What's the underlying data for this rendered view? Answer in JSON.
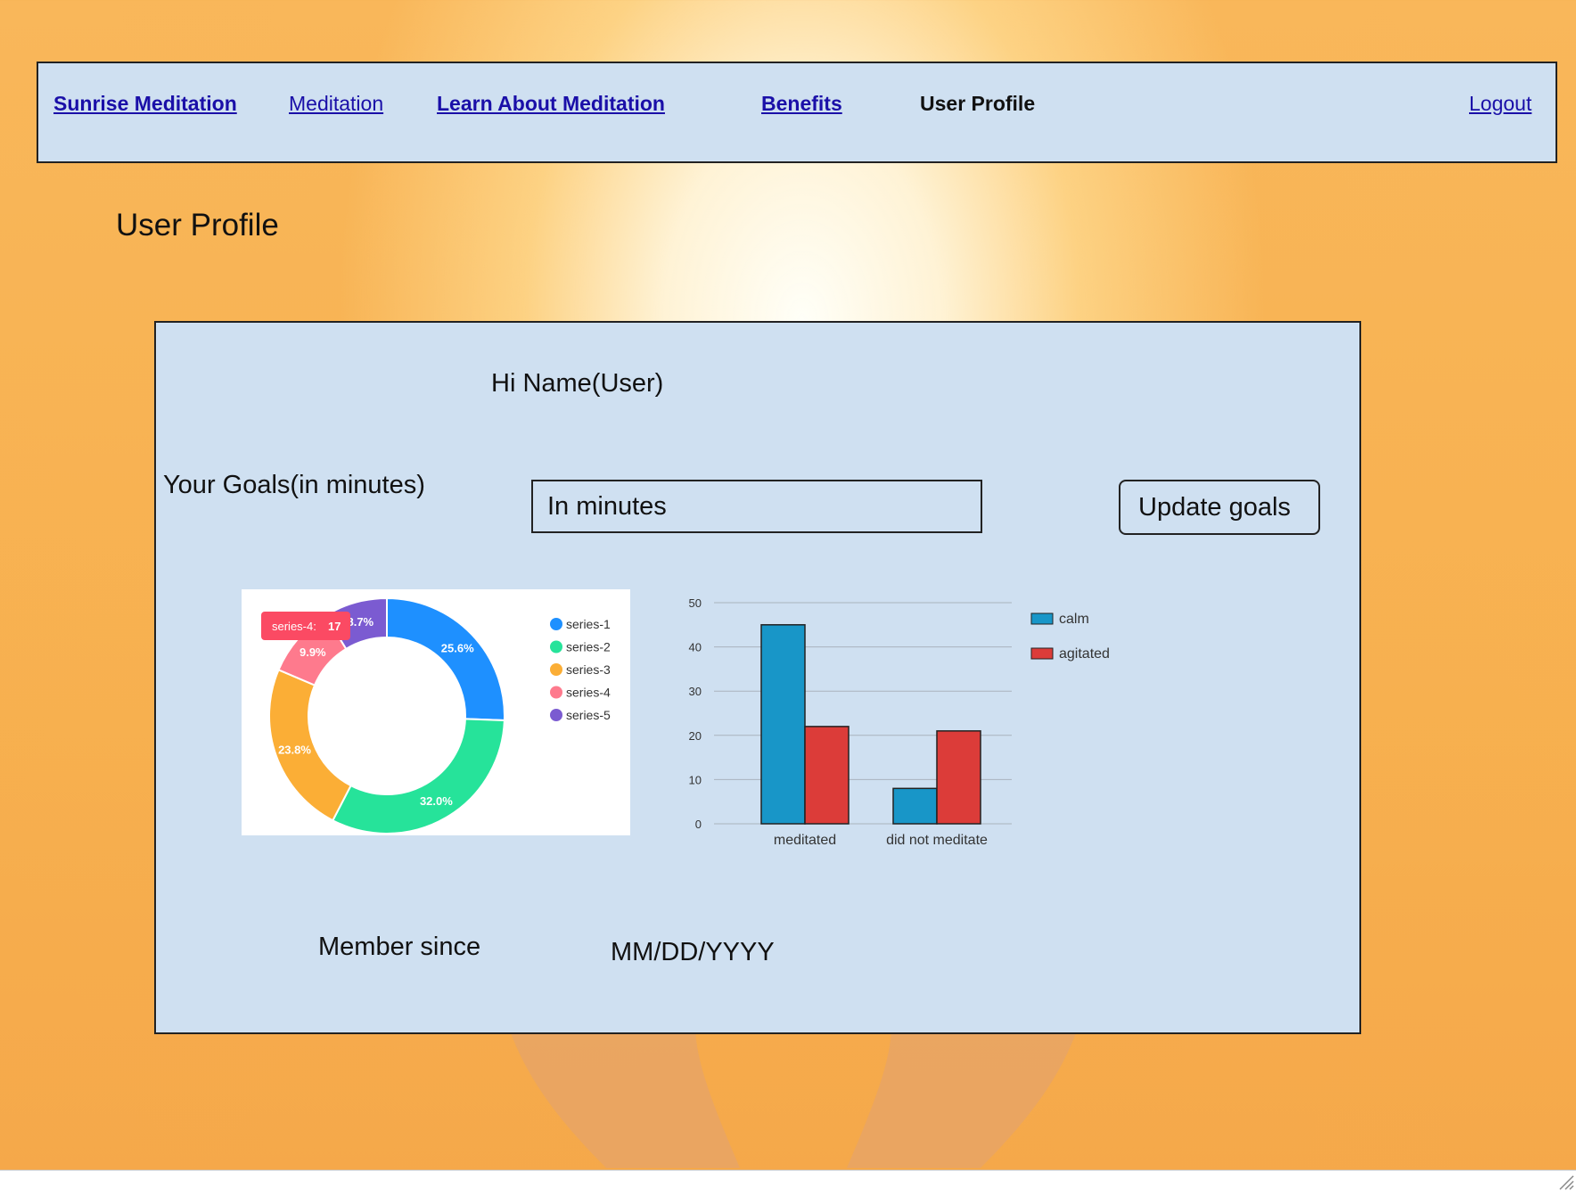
{
  "nav": {
    "brand": "Sunrise Meditation",
    "meditation": "Meditation",
    "learn": "Learn About Meditation",
    "benefits": "Benefits",
    "profile": "User Profile",
    "logout": "Logout"
  },
  "page": {
    "title": "User Profile"
  },
  "panel": {
    "greeting": "Hi Name(User)",
    "goals_label": "Your Goals(in minutes)",
    "goals_placeholder": "In minutes",
    "update_button": "Update goals",
    "member_label": "Member since",
    "member_date": "MM/DD/YYYY"
  },
  "colors": {
    "nav_bg": "#cfe0f1",
    "link": "#1a0fa8",
    "bar_calm": "#1896c8",
    "bar_agitated": "#dc3c39"
  },
  "chart_data": [
    {
      "type": "pie",
      "donut": true,
      "series": [
        {
          "name": "series-1",
          "percent": 25.6,
          "label": "25.6%",
          "color": "#1e90ff"
        },
        {
          "name": "series-2",
          "percent": 32.0,
          "label": "32.0%",
          "color": "#26e39a"
        },
        {
          "name": "series-3",
          "percent": 23.8,
          "label": "23.8%",
          "color": "#fbae36"
        },
        {
          "name": "series-4",
          "percent": 9.9,
          "label": "9.9%",
          "color": "#fe7a8d"
        },
        {
          "name": "series-5",
          "percent": 8.7,
          "label": "8.7%",
          "color": "#7b5bd1"
        }
      ],
      "tooltip": {
        "series": "series-4:",
        "value": "17",
        "color": "#fb4a63"
      },
      "legend": "right"
    },
    {
      "type": "bar",
      "categories": [
        "meditated",
        "did not meditate"
      ],
      "series": [
        {
          "name": "calm",
          "values": [
            45,
            8
          ],
          "color": "#1896c8"
        },
        {
          "name": "agitated",
          "values": [
            22,
            21
          ],
          "color": "#dc3c39"
        }
      ],
      "ylim": [
        0,
        50
      ],
      "yticks": [
        "0",
        "10",
        "20",
        "30",
        "40",
        "50"
      ],
      "grid": true,
      "legend": "right"
    }
  ]
}
